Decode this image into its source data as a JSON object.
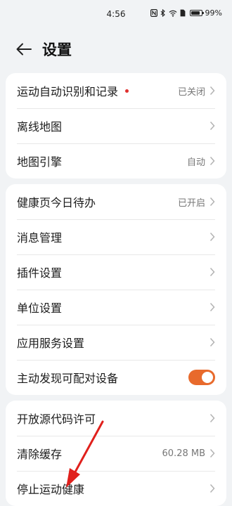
{
  "status_bar": {
    "time": "4:56",
    "battery": "99%"
  },
  "header": {
    "title": "设置"
  },
  "groups": [
    {
      "rows": [
        {
          "label": "运动自动识别和记录",
          "value": "已关闭",
          "dot": true,
          "control": "chevron"
        },
        {
          "label": "离线地图",
          "value": "",
          "dot": false,
          "control": "chevron"
        },
        {
          "label": "地图引擎",
          "value": "自动",
          "dot": false,
          "control": "chevron"
        }
      ]
    },
    {
      "rows": [
        {
          "label": "健康页今日待办",
          "value": "已开启",
          "dot": false,
          "control": "chevron"
        },
        {
          "label": "消息管理",
          "value": "",
          "dot": false,
          "control": "chevron"
        },
        {
          "label": "插件设置",
          "value": "",
          "dot": false,
          "control": "chevron"
        },
        {
          "label": "单位设置",
          "value": "",
          "dot": false,
          "control": "chevron"
        },
        {
          "label": "应用服务设置",
          "value": "",
          "dot": false,
          "control": "chevron"
        },
        {
          "label": "主动发现可配对设备",
          "value": "",
          "dot": false,
          "control": "toggle",
          "toggle_on": true
        }
      ]
    },
    {
      "rows": [
        {
          "label": "开放源代码许可",
          "value": "",
          "dot": false,
          "control": "chevron"
        },
        {
          "label": "清除缓存",
          "value": "60.28 MB",
          "dot": false,
          "control": "chevron"
        },
        {
          "label": "停止运动健康",
          "value": "",
          "dot": false,
          "control": "chevron"
        }
      ]
    }
  ],
  "colors": {
    "accent": "#e86a2c",
    "annotation_arrow": "#e0201c",
    "badge_dot": "#e0312f"
  }
}
